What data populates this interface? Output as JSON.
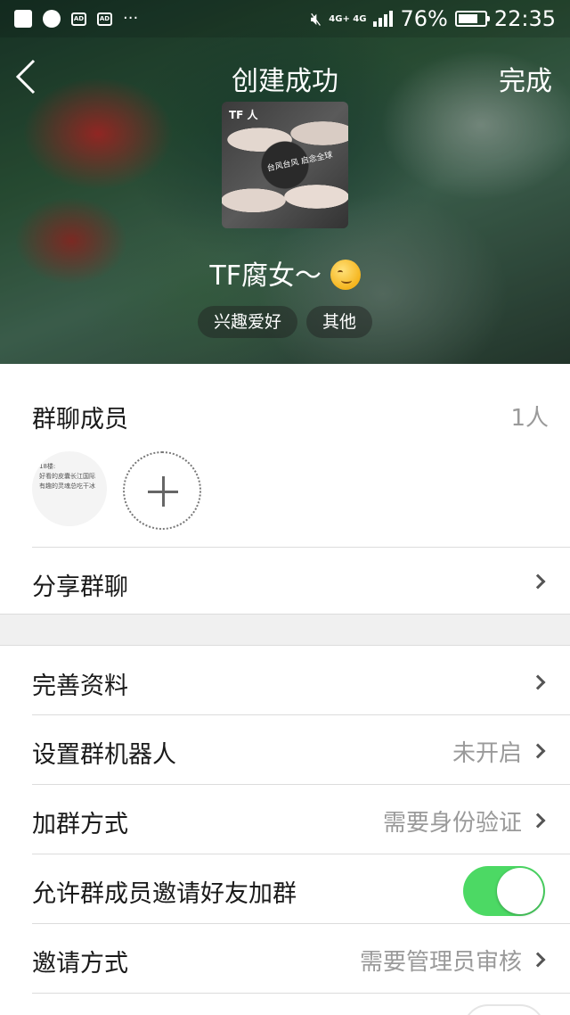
{
  "status_bar": {
    "battery": "76%",
    "time": "22:35",
    "network": "4G+ 4G",
    "more": "···",
    "ad1": "AD",
    "ad2": "AD"
  },
  "navbar": {
    "title": "创建成功",
    "done": "完成"
  },
  "group": {
    "avatar_text_top": "TF 人",
    "avatar_text_mid": "台风台风 启念全球",
    "name": "TF腐女～",
    "tags": [
      "兴趣爱好",
      "其他"
    ]
  },
  "members": {
    "title": "群聊成员",
    "count": "1人",
    "avatar_lines": [
      "18楼:",
      "好看的皮囊长江国际",
      "有趣的灵魂总吃干冰"
    ]
  },
  "rows": {
    "share": {
      "label": "分享群聊"
    },
    "profile": {
      "label": "完善资料"
    },
    "robot": {
      "label": "设置群机器人",
      "value": "未开启"
    },
    "join": {
      "label": "加群方式",
      "value": "需要身份验证"
    },
    "invite_allow": {
      "label": "允许群成员邀请好友加群",
      "on": true
    },
    "invite_method": {
      "label": "邀请方式",
      "value": "需要管理员审核"
    }
  },
  "colors": {
    "toggle_on": "#4cd964",
    "secondary_text": "#9a9a9a"
  }
}
